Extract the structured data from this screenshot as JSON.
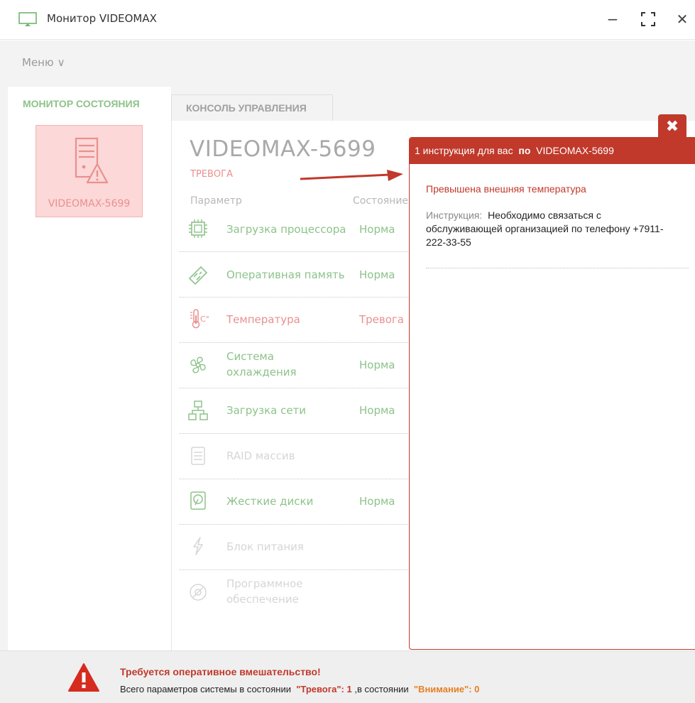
{
  "window": {
    "title": "Монитор VIDEOMAX",
    "minimize_glyph": "−",
    "maximize_glyph": "⛶",
    "close_glyph": "✕"
  },
  "menu": {
    "label": "Меню",
    "chevron": "∨"
  },
  "tabs": [
    {
      "label": "МОНИТОР СОСТОЯНИЯ",
      "active": true
    },
    {
      "label": "КОНСОЛЬ УПРАВЛЕНИЯ",
      "active": false
    }
  ],
  "device_tile": {
    "label": "VIDEOMAX-5699",
    "icon": "server-warning-icon"
  },
  "device": {
    "name": "VIDEOMAX-5699",
    "status": "ТРЕВОГА",
    "col_param": "Параметр",
    "col_state": "Состояние"
  },
  "params": [
    {
      "name": "Загрузка процессора",
      "state": "Норма",
      "icon": "cpu-icon",
      "tone": "norm"
    },
    {
      "name": "Оперативная память",
      "state": "Норма",
      "icon": "ram-icon",
      "tone": "norm"
    },
    {
      "name": "Температура",
      "state": "Тревога",
      "icon": "thermometer-icon",
      "tone": "alarm"
    },
    {
      "name": "Система охлаждения",
      "state": "Норма",
      "icon": "fan-icon",
      "tone": "norm"
    },
    {
      "name": "Загрузка сети",
      "state": "Норма",
      "icon": "network-icon",
      "tone": "norm"
    },
    {
      "name": "RAID массив",
      "state": "",
      "icon": "raid-icon",
      "tone": "dim"
    },
    {
      "name": "Жесткие диски",
      "state": "Норма",
      "icon": "hdd-icon",
      "tone": "norm"
    },
    {
      "name": "Блок питания",
      "state": "",
      "icon": "power-icon",
      "tone": "dim"
    },
    {
      "name": "Программное обеспечение",
      "state": "",
      "icon": "software-icon",
      "tone": "dim"
    }
  ],
  "popup": {
    "header_count": "1 инструкция для вас",
    "header_po": "по",
    "header_device": "VIDEOMAX-5699",
    "close_glyph": "✖",
    "problem": "Превышена внешняя температура",
    "instr_label": "Инструкция:",
    "instr_text": "Необходимо связаться с обслуживающей организацией по телефону +7911-222-33-55"
  },
  "footer": {
    "title": "Требуется оперативное вмешательство!",
    "prefix": "Всего параметров системы в состоянии",
    "alarm_label": "\"Тревога\": 1",
    "middle": ",в состоянии",
    "attention_label": "\"Внимание\": 0"
  },
  "colors": {
    "alarm": "#c0392b",
    "norm": "#8dc38a",
    "soft_alarm": "#e9908f",
    "attention": "#e67e22"
  }
}
